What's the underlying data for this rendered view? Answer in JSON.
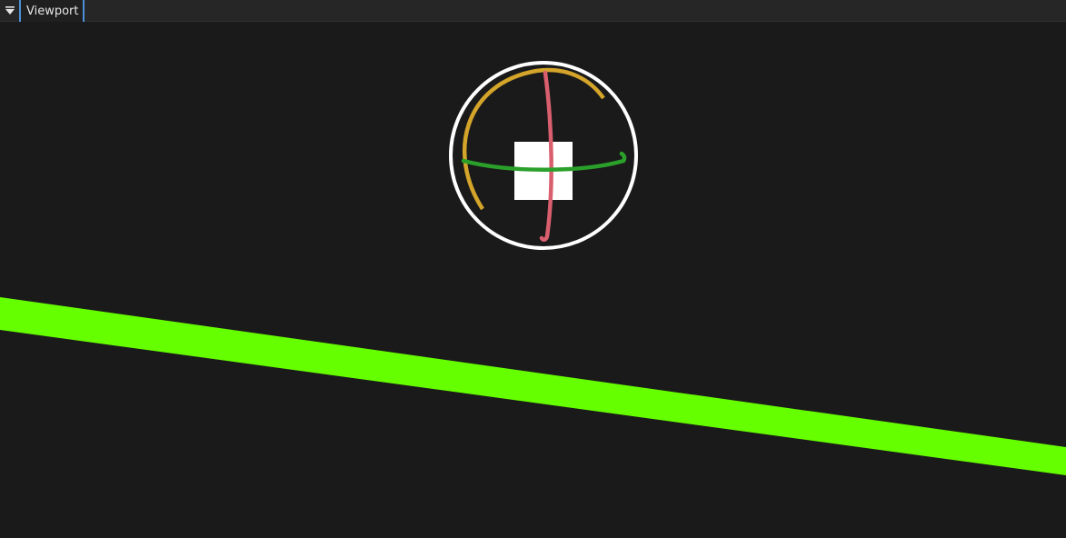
{
  "tabbar": {
    "menu_icon": "dropdown-triangle-icon",
    "active_tab_label": "Viewport"
  },
  "colors": {
    "background": "#1a1a1a",
    "tabbar": "#262626",
    "tab_accent": "#4d8fd8",
    "gizmo_ring": "#ffffff",
    "gizmo_pitch": "#d4a52a",
    "gizmo_roll": "#d95f6e",
    "gizmo_yaw": "#2aa02a",
    "ground_line": "#66ff00",
    "object": "#ffffff"
  },
  "viewport": {
    "icons": [
      "rotation-gizmo-icon",
      "ground-plane",
      "selected-object"
    ]
  }
}
